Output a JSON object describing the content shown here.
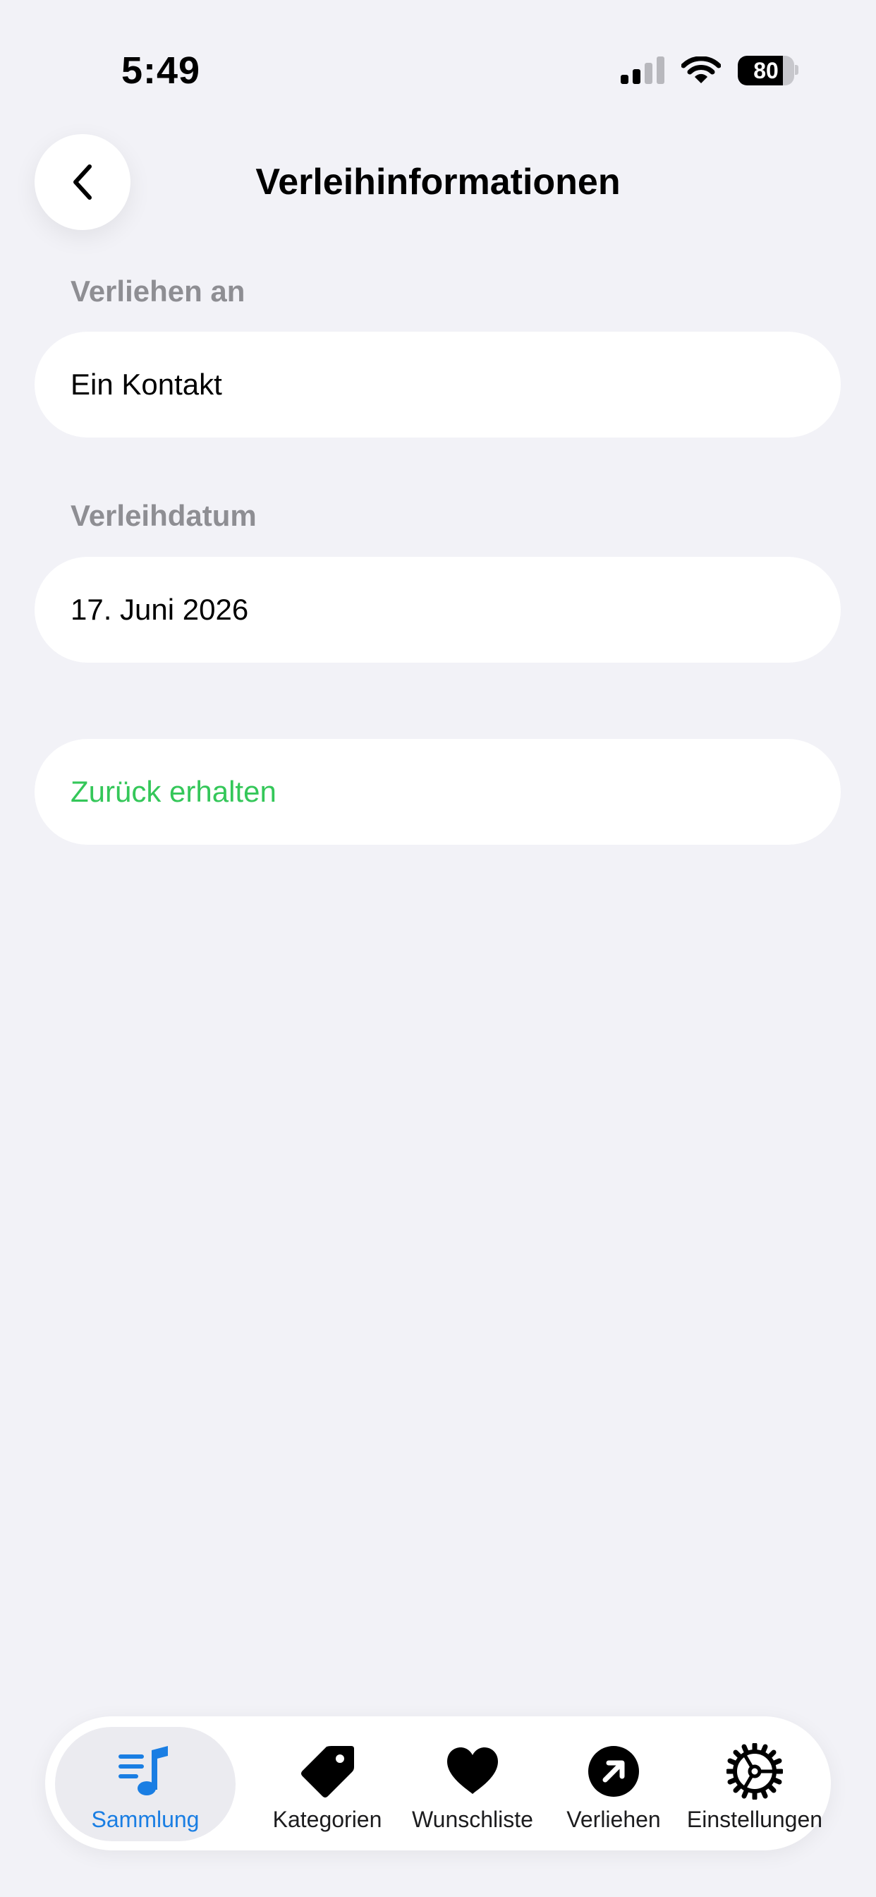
{
  "status_bar": {
    "time": "5:49",
    "battery_level": "80",
    "battery_fraction": 0.8,
    "icons": [
      "cellular-signal-icon",
      "wifi-icon",
      "battery-icon"
    ]
  },
  "header": {
    "title": "Verleihinformationen",
    "back_icon": "chevron-left-icon"
  },
  "form": {
    "lent_to_label": "Verliehen an",
    "lent_to_value": "Ein Kontakt",
    "lend_date_label": "Verleihdatum",
    "lend_date_value": "17. Juni 2026",
    "return_action": "Zurück erhalten"
  },
  "tabbar": {
    "items": [
      {
        "label": "Sammlung",
        "icon": "music-list-icon",
        "active": true
      },
      {
        "label": "Kategorien",
        "icon": "tag-icon",
        "active": false
      },
      {
        "label": "Wunschliste",
        "icon": "heart-icon",
        "active": false
      },
      {
        "label": "Verliehen",
        "icon": "arrow-up-right-circle-icon",
        "active": false
      },
      {
        "label": "Einstellungen",
        "icon": "gear-icon",
        "active": false
      }
    ]
  },
  "colors": {
    "background": "#f2f2f7",
    "card": "#ffffff",
    "accent_blue": "#1a7ee3",
    "accent_green": "#34c759",
    "label_gray": "#8e8e93",
    "tab_active_bg": "#ebebf0"
  }
}
